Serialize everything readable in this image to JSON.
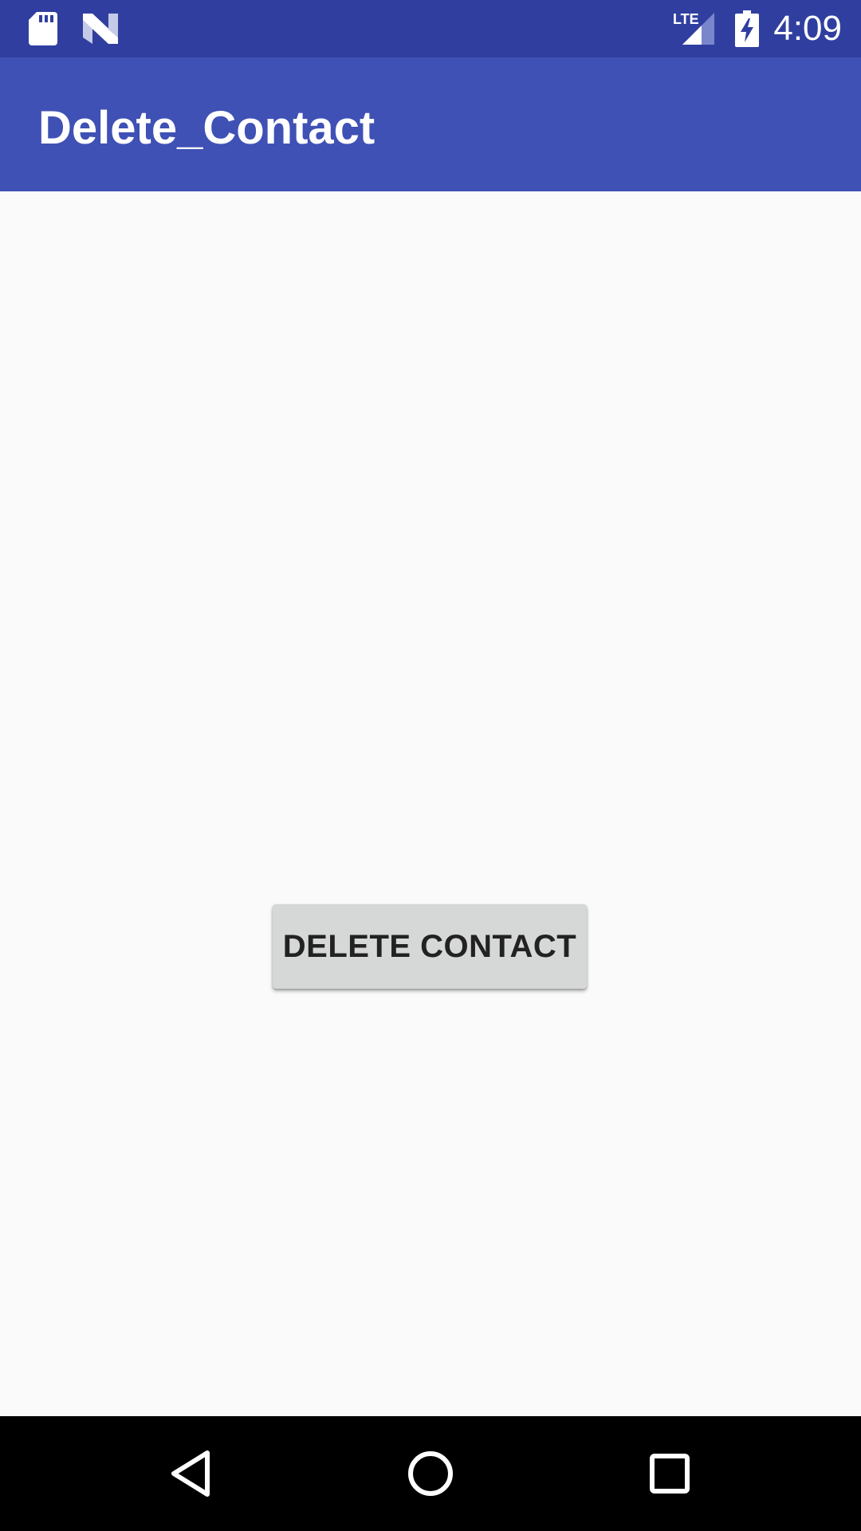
{
  "status_bar": {
    "time": "4:09",
    "network_label": "LTE",
    "icons": [
      "sd-card-icon",
      "n-notification-icon",
      "lte-signal-icon",
      "battery-charging-icon"
    ]
  },
  "app_bar": {
    "title": "Delete_Contact",
    "color": "#3f51b5",
    "status_color": "#303f9f"
  },
  "main": {
    "delete_button_label": "DELETE CONTACT",
    "background": "#fafafa"
  },
  "nav_bar": {
    "icons": [
      "back-icon",
      "home-icon",
      "recents-icon"
    ]
  }
}
